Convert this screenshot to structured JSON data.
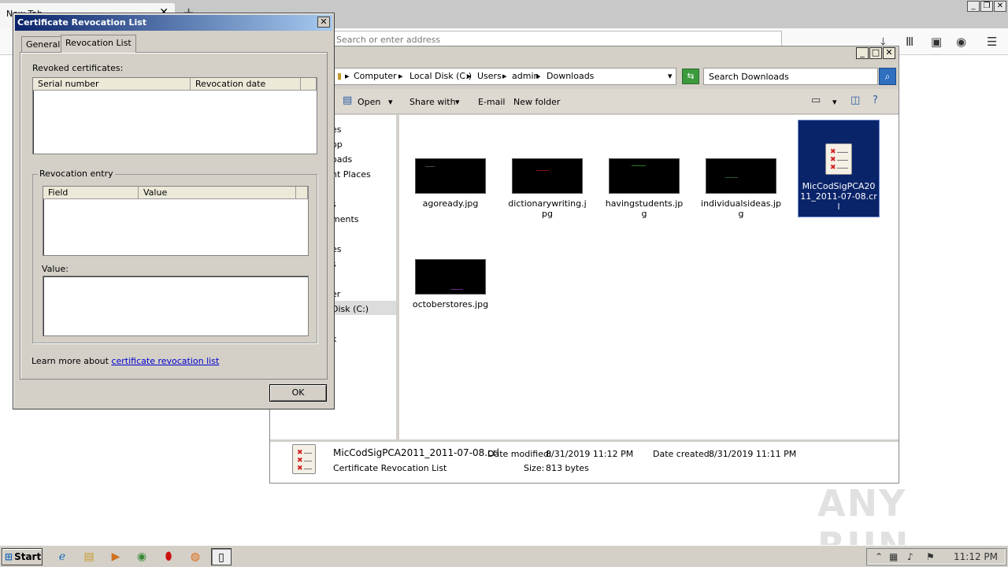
{
  "browser": {
    "tab_title": "New Tab",
    "tab_close": "✕",
    "new_tab": "+",
    "url_placeholder": "Search or enter address"
  },
  "explorer": {
    "breadcrumbs": [
      "Computer",
      "Local Disk (C:)",
      "Users",
      "admin",
      "Downloads"
    ],
    "search_placeholder": "Search Downloads",
    "toolbar": {
      "open": "Open",
      "share_with": "Share with",
      "email": "E-mail",
      "new_folder": "New folder"
    },
    "nav_items": [
      "es",
      "op",
      "oads",
      "nt Places",
      "s",
      "ments",
      "es",
      "s",
      "er",
      "Disk (C:)",
      "k"
    ],
    "files": [
      {
        "name": "agoready.jpg",
        "mark": "#4a4a4a"
      },
      {
        "name": "dictionarywriting.jpg",
        "mark": "#8a1010"
      },
      {
        "name": "havingstudents.jpg",
        "mark": "#2a7a2a"
      },
      {
        "name": "individualsideas.jpg",
        "mark": "#2a5a2a"
      },
      {
        "name": "MicCodSigPCA2011_2011-07-08.crl",
        "selected": true
      },
      {
        "name": "octoberstores.jpg",
        "mark": "#6a2a8a"
      }
    ],
    "details": {
      "filename": "MicCodSigPCA2011_2011-07-08.crl",
      "type": "Certificate Revocation List",
      "date_modified_label": "Date modified:",
      "date_modified": "8/31/2019 11:12 PM",
      "date_created_label": "Date created:",
      "date_created": "8/31/2019 11:11 PM",
      "size_label": "Size:",
      "size": "813 bytes"
    }
  },
  "dialog": {
    "title": "Certificate Revocation List",
    "tabs": [
      "General",
      "Revocation List"
    ],
    "revoked_label": "Revoked certificates:",
    "revoked_columns": [
      "Serial number",
      "Revocation date"
    ],
    "entry_group": "Revocation entry",
    "entry_columns": [
      "Field",
      "Value"
    ],
    "value_label": "Value:",
    "learn_more_prefix": "Learn more about ",
    "learn_more_link": "certificate revocation list",
    "ok": "OK"
  },
  "taskbar": {
    "start": "Start",
    "clock": "11:12 PM"
  },
  "watermark": "ANY RUN"
}
